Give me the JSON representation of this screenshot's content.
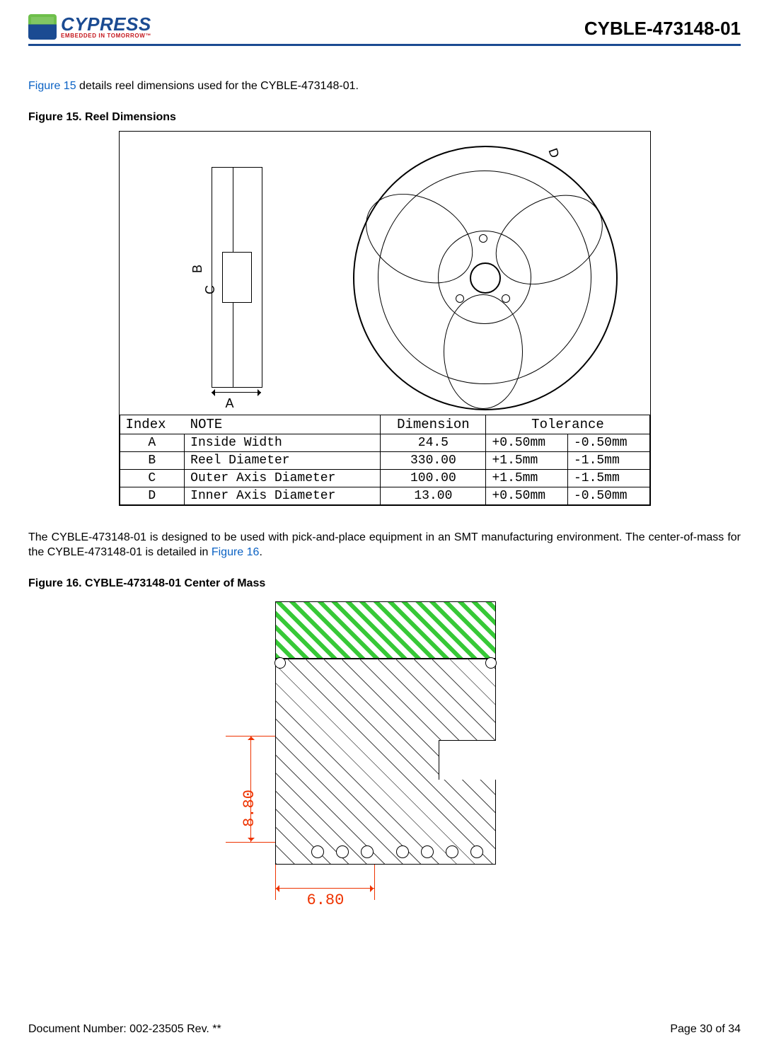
{
  "header": {
    "logo_top": "CYPRESS",
    "logo_bottom": "EMBEDDED IN TOMORROW™",
    "part_number": "CYBLE-473148-01"
  },
  "intro1_pre": "Figure 15",
  "intro1_post": " details reel dimensions used for the CYBLE-473148-01.",
  "fig15_title": "Figure 15.  Reel Dimensions",
  "reel_labels": {
    "A": "A",
    "B": "B",
    "C": "C",
    "D": "D"
  },
  "dim_table": {
    "headers": {
      "index": "Index",
      "note": "NOTE",
      "dimension": "Dimension",
      "tolerance": "Tolerance"
    },
    "rows": [
      {
        "index": "A",
        "note": "Inside Width",
        "dimension": "24.5",
        "tol_p": "+0.50mm",
        "tol_n": "-0.50mm"
      },
      {
        "index": "B",
        "note": "Reel Diameter",
        "dimension": "330.00",
        "tol_p": "+1.5mm",
        "tol_n": "-1.5mm"
      },
      {
        "index": "C",
        "note": "Outer Axis Diameter",
        "dimension": "100.00",
        "tol_p": "+1.5mm",
        "tol_n": "-1.5mm"
      },
      {
        "index": "D",
        "note": "Inner Axis Diameter",
        "dimension": "13.00",
        "tol_p": "+0.50mm",
        "tol_n": "-0.50mm"
      }
    ]
  },
  "intro2_pre": "The CYBLE-473148-01 is designed to be used with pick-and-place equipment in an SMT manufacturing environment. The center-of-mass for the CYBLE-473148-01 is detailed in ",
  "intro2_link": "Figure 16",
  "intro2_post": ".",
  "fig16_title": "Figure 16.  CYBLE-473148-01 Center of Mass",
  "com": {
    "x": "6.80",
    "y": "8.80"
  },
  "footer": {
    "doc": "Document Number:  002-23505 Rev. **",
    "page": "Page 30 of 34"
  }
}
